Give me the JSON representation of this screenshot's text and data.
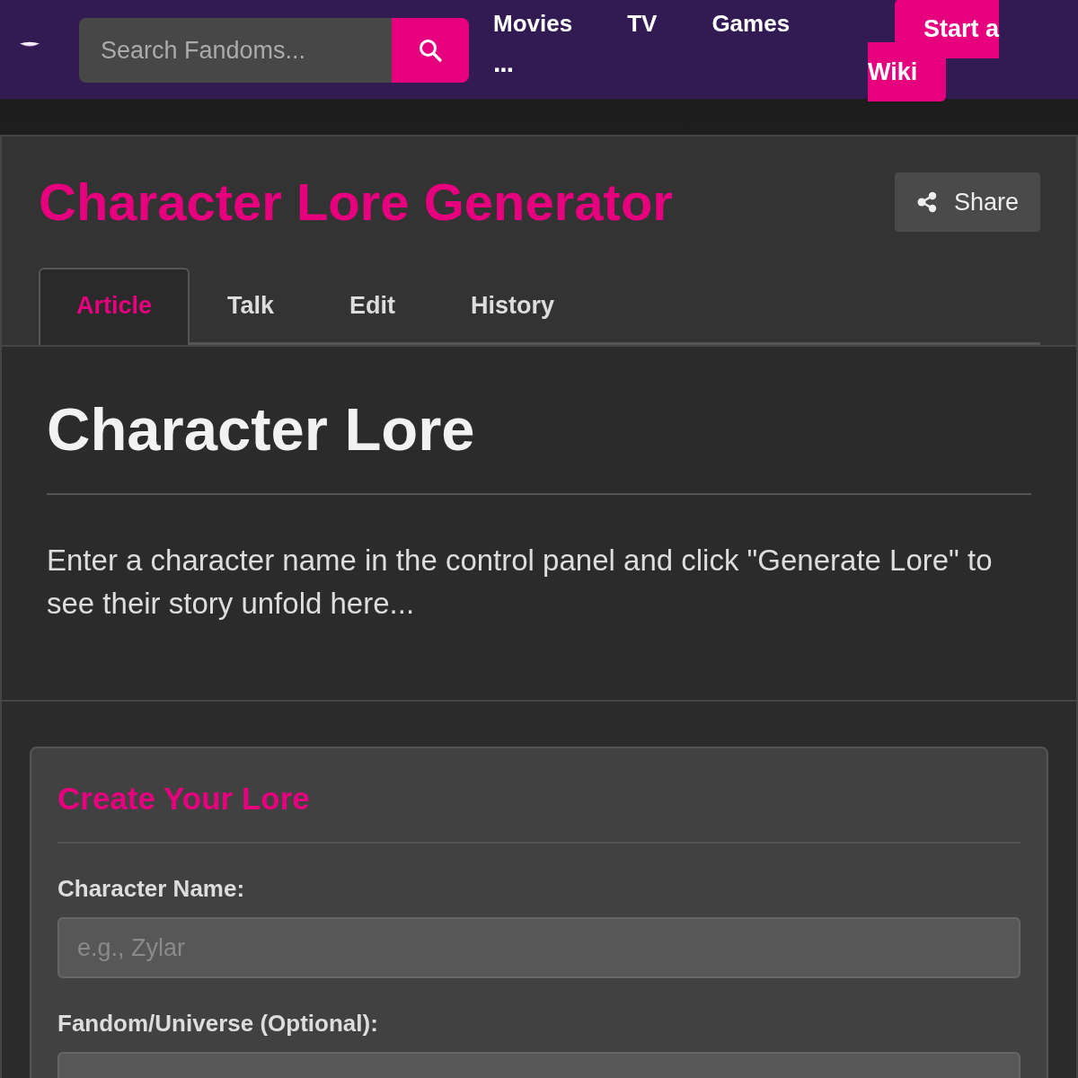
{
  "nav": {
    "search": {
      "placeholder": "Search Fandoms..."
    },
    "links": [
      {
        "label": "Movies",
        "kind": "link"
      },
      {
        "label": "TV",
        "kind": "link"
      },
      {
        "label": "Games",
        "kind": "link"
      },
      {
        "label": "...",
        "kind": "more"
      }
    ],
    "cta": "Start a Wiki"
  },
  "header": {
    "title": "Character Lore Generator",
    "share": "Share",
    "tabs": [
      {
        "label": "Article",
        "selected": true
      },
      {
        "label": "Talk",
        "selected": false
      },
      {
        "label": "Edit",
        "selected": false
      },
      {
        "label": "History",
        "selected": false
      }
    ]
  },
  "article": {
    "heading": "Character Lore",
    "text": "Enter a character name in the control panel and click \"Generate Lore\" to see their story unfold here..."
  },
  "panel": {
    "title": "Create Your Lore",
    "fields": [
      {
        "label": "Character Name:",
        "placeholder": "e.g., Zylar"
      },
      {
        "label": "Fandom/Universe (Optional):"
      }
    ]
  }
}
